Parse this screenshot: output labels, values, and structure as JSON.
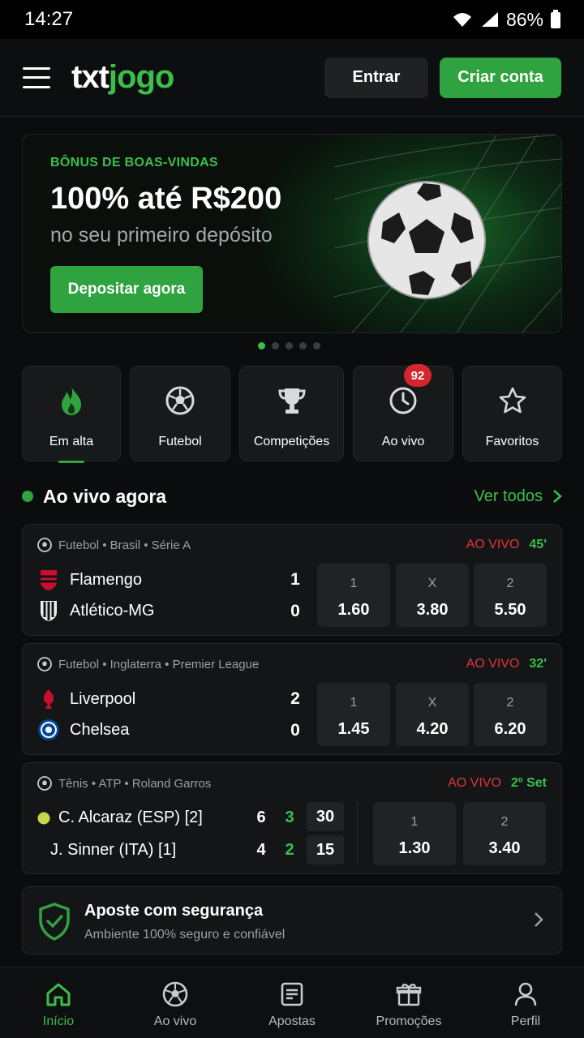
{
  "status": {
    "time": "14:27",
    "battery": "86%"
  },
  "header": {
    "logo_a": "txt",
    "logo_b": "jogo",
    "login": "Entrar",
    "signup": "Criar conta"
  },
  "banner": {
    "kicker": "BÔNUS DE BOAS-VINDAS",
    "headline": "100% até R$200",
    "sub": "no seu primeiro depósito",
    "cta": "Depositar agora",
    "slides": 5,
    "active_slide": 1
  },
  "categories": [
    {
      "label": "Em alta",
      "icon": "flame-icon",
      "active": true
    },
    {
      "label": "Futebol",
      "icon": "soccer-ball-icon"
    },
    {
      "label": "Competições",
      "icon": "trophy-icon"
    },
    {
      "label": "Ao vivo",
      "icon": "clock-icon",
      "badge": "92"
    },
    {
      "label": "Favoritos",
      "icon": "star-icon"
    }
  ],
  "live": {
    "title": "Ao vivo agora",
    "see_all": "Ver todos",
    "matches": [
      {
        "meta": "Futebol • Brasil • Série A",
        "live": "AO VIVO",
        "minute": "45'",
        "home": "Flamengo",
        "away": "Atlético-MG",
        "home_score": "1",
        "away_score": "0",
        "odds": [
          {
            "k": "1",
            "v": "1.60"
          },
          {
            "k": "X",
            "v": "3.80"
          },
          {
            "k": "2",
            "v": "5.50"
          }
        ]
      },
      {
        "meta": "Futebol • Inglaterra • Premier League",
        "live": "AO VIVO",
        "minute": "32'",
        "home": "Liverpool",
        "away": "Chelsea",
        "home_score": "2",
        "away_score": "0",
        "odds": [
          {
            "k": "1",
            "v": "1.45"
          },
          {
            "k": "X",
            "v": "4.20"
          },
          {
            "k": "2",
            "v": "6.20"
          }
        ]
      },
      {
        "meta": "Tênis • ATP • Roland Garros",
        "live": "AO VIVO",
        "minute": "2º Set",
        "p1": "C. Alcaraz (ESP) [2]",
        "p2": "J. Sinner (ITA) [1]",
        "p1_set1": "6",
        "p1_set2": "3",
        "p1_pts": "30",
        "p2_set1": "4",
        "p2_set2": "2",
        "p2_pts": "15",
        "odds": [
          {
            "k": "1",
            "v": "1.30"
          },
          {
            "k": "2",
            "v": "3.40"
          }
        ]
      }
    ]
  },
  "safe": {
    "title": "Aposte com segurança",
    "sub": "Ambiente 100% seguro e confiável"
  },
  "nav": [
    {
      "label": "Início",
      "active": true
    },
    {
      "label": "Ao vivo"
    },
    {
      "label": "Apostas"
    },
    {
      "label": "Promoções"
    },
    {
      "label": "Perfil"
    }
  ],
  "colors": {
    "accent": "#2fa33f",
    "live": "#e2353a",
    "bg": "#0b0c0d",
    "card": "#131517"
  }
}
